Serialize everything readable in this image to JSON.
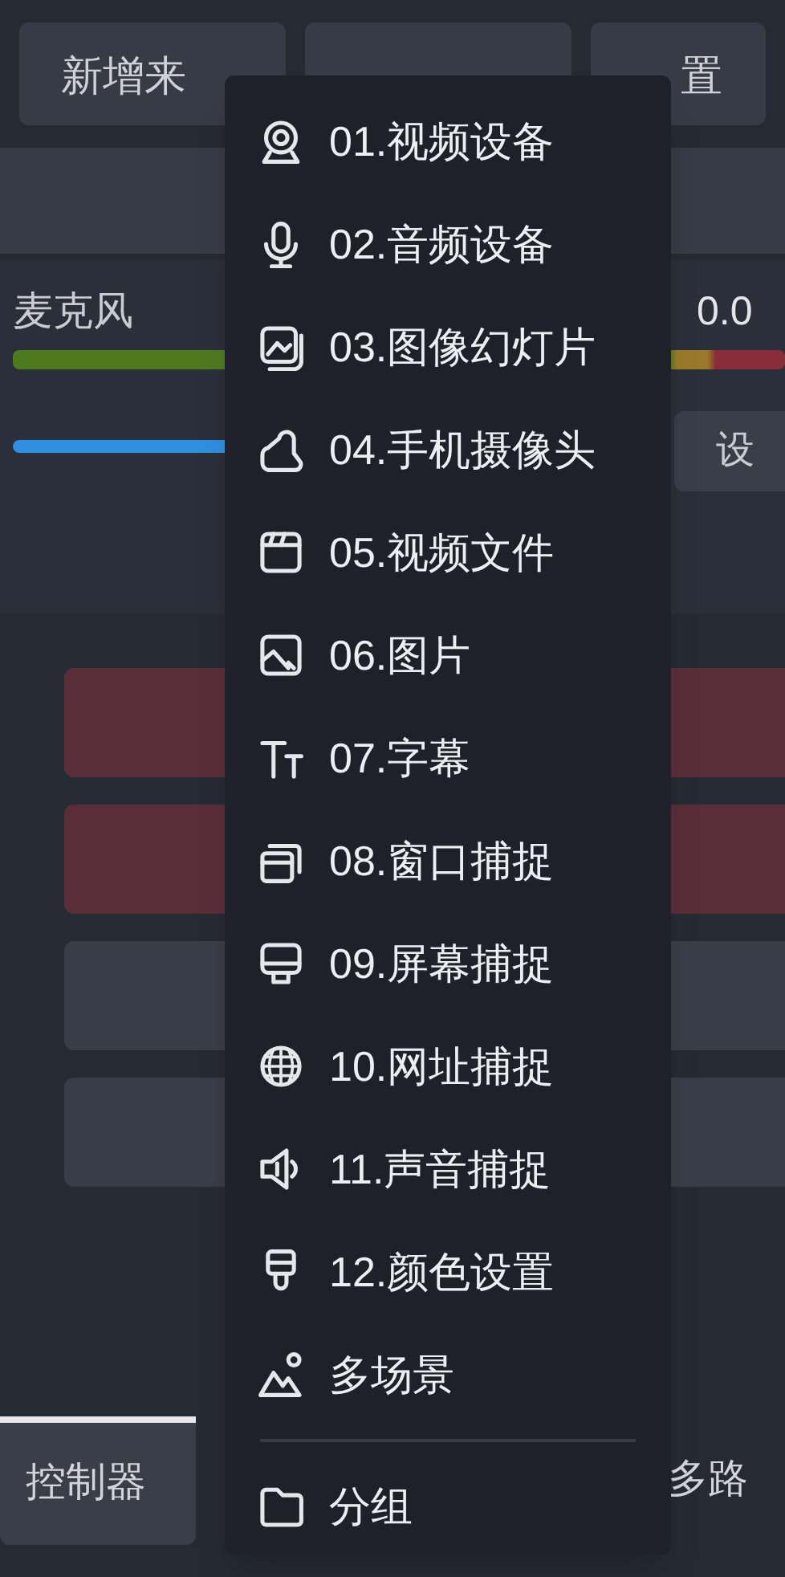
{
  "toolbar": {
    "buttons": [
      {
        "label": "新增来"
      },
      {
        "kind": "covered"
      },
      {
        "label": "置"
      }
    ]
  },
  "mixer": {
    "channel": "麦克风",
    "reading": "0.0",
    "settings_button": "设"
  },
  "source_cards": [
    {
      "kind": "alert"
    },
    {
      "kind": "alert"
    },
    {
      "kind": "normal"
    },
    {
      "kind": "normal"
    }
  ],
  "bottom_tabs": [
    {
      "label": "控制器",
      "selected": true
    },
    {
      "label": "多路",
      "selected": false
    }
  ],
  "menu": {
    "sections": [
      [
        {
          "label": "01.视频设备"
        },
        {
          "label": "02.音频设备"
        },
        {
          "label": "03.图像幻灯片"
        },
        {
          "label": "04.手机摄像头"
        },
        {
          "label": "05.视频文件"
        },
        {
          "label": "06.图片"
        },
        {
          "label": "07.字幕"
        },
        {
          "label": "08.窗口捕捉"
        },
        {
          "label": "09.屏幕捕捉"
        },
        {
          "label": "10.网址捕捉"
        },
        {
          "label": "11.声音捕捉"
        },
        {
          "label": "12.颜色设置"
        },
        {
          "label": "多场景"
        }
      ],
      [
        {
          "label": "分组"
        }
      ]
    ]
  }
}
